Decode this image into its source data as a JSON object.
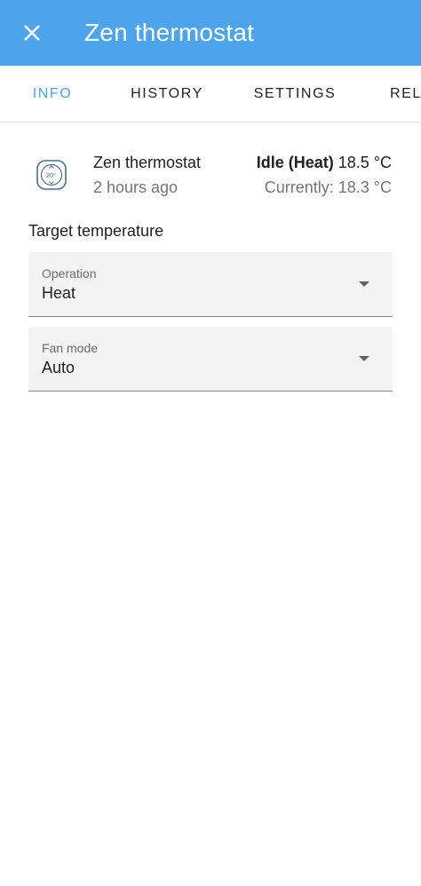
{
  "header": {
    "title": "Zen thermostat",
    "close_icon": "close-icon"
  },
  "tabs": [
    {
      "label": "INFO",
      "active": true
    },
    {
      "label": "HISTORY",
      "active": false
    },
    {
      "label": "SETTINGS",
      "active": false
    },
    {
      "label": "REL...",
      "active": false
    }
  ],
  "entity": {
    "name": "Zen thermostat",
    "last_changed": "2 hours ago",
    "icon": "thermostat-icon",
    "icon_text": "20°",
    "state_label": "Idle (Heat)",
    "target": "18.5 °C",
    "current": "Currently: 18.3 °C"
  },
  "target_section": {
    "label": "Target temperature"
  },
  "operation_select": {
    "label": "Operation",
    "value": "Heat"
  },
  "fan_select": {
    "label": "Fan mode",
    "value": "Auto"
  },
  "colors": {
    "accent": "#4da4ea",
    "field_bg": "#f4f4f4",
    "secondary_text": "#757575"
  }
}
